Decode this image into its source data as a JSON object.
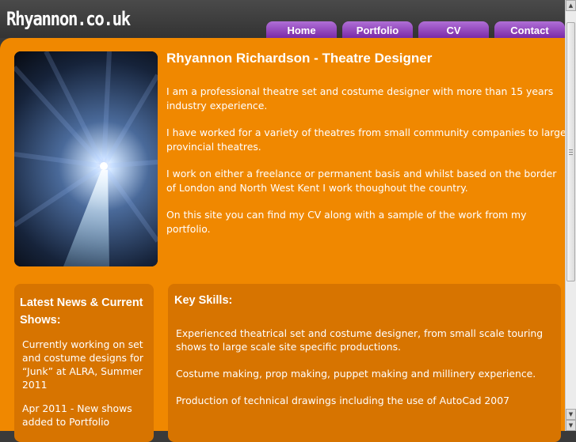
{
  "site": {
    "logo": "Rhyannon.co.uk"
  },
  "nav": {
    "items": [
      {
        "label": "Home"
      },
      {
        "label": "Portfolio"
      },
      {
        "label": "CV"
      },
      {
        "label": "Contact"
      }
    ]
  },
  "hero": {
    "icon": "stage-light-image"
  },
  "intro": {
    "title": "Rhyannon Richardson - Theatre Designer",
    "paragraphs": [
      "I am a professional theatre set and costume designer with more than 15 years industry experience.",
      "I have worked for a variety of theatres from small community companies to large provincial theatres.",
      "I work on either a freelance or permanent basis and whilst based on the border of London and North West Kent I work thoughout the country.",
      "On this site you can find my CV along with a sample of the work from my portfolio."
    ]
  },
  "news": {
    "title": "Latest News & Current Shows:",
    "items": [
      "Currently working on set and costume designs for “Junk” at ALRA, Summer 2011",
      "Apr 2011 - New shows added to Portfolio"
    ]
  },
  "skills": {
    "title": "Key Skills:",
    "items": [
      "Experienced theatrical set and costume designer, from small scale touring shows to large scale site specific productions.",
      "Costume making, prop making, puppet making and millinery experience.",
      "Production of technical drawings including the use of AutoCad 2007"
    ]
  },
  "colors": {
    "page_bg": "#3a3a3a",
    "main_bg": "#f08800",
    "panel_bg": "#d77400",
    "nav_bg": "#9a4cc6"
  }
}
